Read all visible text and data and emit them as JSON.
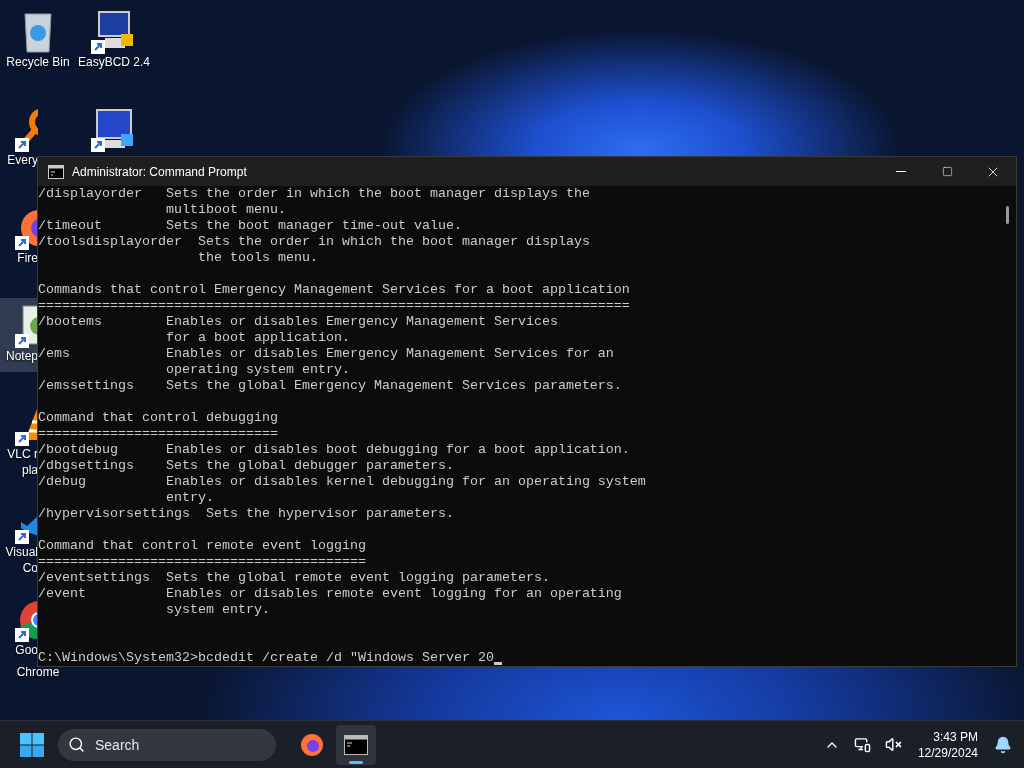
{
  "desktop": {
    "icons": [
      {
        "kind": "recycle-bin",
        "selected": false,
        "shortcut": false,
        "art_covered": false,
        "label": [
          {
            "text": "Recycle Bin",
            "clipped": false
          }
        ]
      },
      {
        "kind": "search-tool",
        "selected": false,
        "shortcut": true,
        "art_covered": true,
        "label": [
          {
            "text": "Every",
            "clipped": true
          }
        ]
      },
      {
        "kind": "browser-fox",
        "selected": false,
        "shortcut": true,
        "art_covered": true,
        "label": [
          {
            "text": "Fire",
            "clipped": true
          }
        ]
      },
      {
        "kind": "notepad",
        "selected": true,
        "shortcut": true,
        "art_covered": true,
        "label": [
          {
            "text": "Notep",
            "clipped": true
          }
        ]
      },
      {
        "kind": "cone",
        "selected": false,
        "shortcut": true,
        "art_covered": true,
        "label": [
          {
            "text": "VLC r",
            "clipped": true
          },
          {
            "text": "pla",
            "clipped": true
          }
        ]
      },
      {
        "kind": "code-editor",
        "selected": false,
        "shortcut": true,
        "art_covered": true,
        "label": [
          {
            "text": "Visual",
            "clipped": true
          },
          {
            "text": "Co",
            "clipped": true
          }
        ]
      },
      {
        "kind": "browser-ring",
        "selected": false,
        "shortcut": true,
        "art_covered": true,
        "label": [
          {
            "text": "Goo",
            "clipped": true
          },
          {
            "text": "Chrome",
            "clipped": false
          }
        ]
      },
      {
        "kind": "computer",
        "selected": false,
        "shortcut": true,
        "art_covered": false,
        "label": [
          {
            "text": "EasyBCD 2.4",
            "clipped": false
          }
        ]
      },
      {
        "kind": "computer-uefi",
        "selected": false,
        "shortcut": true,
        "art_covered": false
      }
    ]
  },
  "window": {
    "title": "Administrator: Command Prompt",
    "blocks": [
      {
        "lines": [
          "/displayorder   Sets the order in which the boot manager displays the",
          "                multiboot menu.",
          "/timeout        Sets the boot manager time-out value.",
          "/toolsdisplayorder  Sets the order in which the boot manager displays",
          "                    the tools menu."
        ]
      },
      {
        "lines": [
          "Commands that control Emergency Management Services for a boot application",
          "==========================================================================",
          "/bootems        Enables or disables Emergency Management Services",
          "                for a boot application.",
          "/ems            Enables or disables Emergency Management Services for an",
          "                operating system entry.",
          "/emssettings    Sets the global Emergency Management Services parameters."
        ]
      },
      {
        "lines": [
          "Command that control debugging",
          "==============================",
          "/bootdebug      Enables or disables boot debugging for a boot application.",
          "/dbgsettings    Sets the global debugger parameters.",
          "/debug          Enables or disables kernel debugging for an operating system",
          "                entry.",
          "/hypervisorsettings  Sets the hypervisor parameters."
        ]
      },
      {
        "lines": [
          "Command that control remote event logging",
          "=========================================",
          "/eventsettings  Sets the global remote event logging parameters.",
          "/event          Enables or disables remote event logging for an operating",
          "                system entry."
        ]
      }
    ],
    "prompt": "C:\\Windows\\System32>bcdedit /create /d \"Windows Server 20"
  },
  "taskbar": {
    "search": {
      "placeholder": "Search"
    },
    "apps": [
      {
        "kind": "browser-fox",
        "active": false
      },
      {
        "kind": "terminal",
        "active": true
      }
    ],
    "clock": {
      "time": "3:43 PM",
      "date": "12/29/2024"
    }
  }
}
